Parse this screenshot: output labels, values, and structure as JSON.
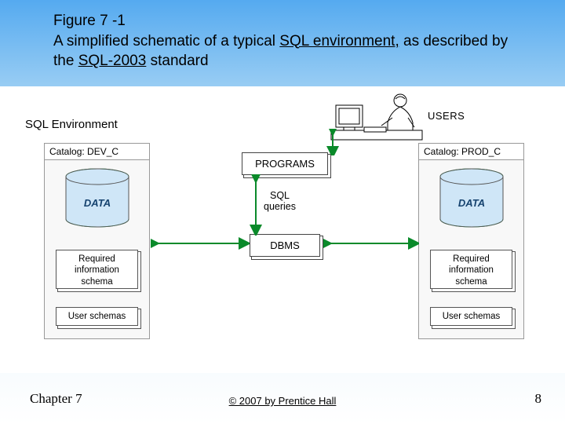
{
  "title": {
    "figure_no": "Figure 7 -1",
    "line_pre": "A simplified schematic of a typical ",
    "u1": "SQL environment,",
    "mid": " as described by the ",
    "u2": "SQL-2003",
    "post": " standard"
  },
  "diagram": {
    "env_label": "SQL Environment",
    "programs": "PROGRAMS",
    "sql_queries_l1": "SQL",
    "sql_queries_l2": "queries",
    "dbms": "DBMS",
    "users_label": "USERS",
    "catalog_left": {
      "header": "Catalog: DEV_C",
      "data_label": "DATA",
      "req_l1": "Required",
      "req_l2": "information",
      "req_l3": "schema",
      "user_schema": "User schemas"
    },
    "catalog_right": {
      "header": "Catalog: PROD_C",
      "data_label": "DATA",
      "req_l1": "Required",
      "req_l2": "information",
      "req_l3": "schema",
      "user_schema": "User schemas"
    }
  },
  "footer": {
    "left": "Chapter 7",
    "center": "© 2007 by Prentice Hall",
    "right": "8"
  }
}
